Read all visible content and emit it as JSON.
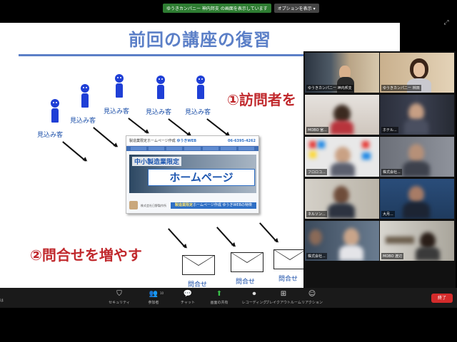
{
  "share_banner": {
    "status_text": "ゆうきカンパニー 神内邦支 の画面を表示しています",
    "options_button": "オプションを表示",
    "options_caret": "▾"
  },
  "top_right_icon": "⤢",
  "slide": {
    "title": "前回の講座の復習",
    "visitor_label": "見込み客",
    "callout_1": "①訪問者を",
    "callout_2": "②問合せを増やす",
    "inquiry_label": "問合せ",
    "homepage": {
      "brand_prefix": "製造業限定ホームページ作成 ",
      "brand_name": "ゆうきWEB",
      "phone": "06-6395-4262",
      "tagline": "中小製造業限定",
      "headline": "ホームページ",
      "caption": "株式会社日野製作所",
      "banner_prefix": "製造業限定",
      "banner_text": "ホームページ作成 ゆうきWEBの特徴"
    }
  },
  "participants": [
    {
      "name": "ゆうきカンパニー 神内邦支",
      "active": true
    },
    {
      "name": "ゆうきカンパニー 林田",
      "active": false
    },
    {
      "name": "MOBO 宮...",
      "active": false
    },
    {
      "name": "ホテル...",
      "active": false
    },
    {
      "name": "フロロコ...",
      "active": false
    },
    {
      "name": "株式会社...",
      "active": false
    },
    {
      "name": "ネルソン...",
      "active": false
    },
    {
      "name": "大月...",
      "active": false
    },
    {
      "name": "株式会社...",
      "active": false
    },
    {
      "name": "MOBO 渡辺",
      "active": false
    }
  ],
  "toolbar": {
    "left_text": "は",
    "participants_count": "10",
    "items": [
      {
        "label": "セキュリティ",
        "icon": "shield-icon",
        "glyph": "⛉"
      },
      {
        "label": "参加者",
        "icon": "participants-icon",
        "glyph": "👥"
      },
      {
        "label": "チャット",
        "icon": "chat-icon",
        "glyph": "💬"
      },
      {
        "label": "画面の共有",
        "icon": "share-screen-icon",
        "glyph": "⬆"
      },
      {
        "label": "レコーディング",
        "icon": "record-icon",
        "glyph": "⏺"
      },
      {
        "label": "ブレイクアウトルーム",
        "icon": "breakout-icon",
        "glyph": "⊞"
      },
      {
        "label": "リアクション",
        "icon": "reaction-icon",
        "glyph": "☺"
      }
    ],
    "end_label": "終了"
  },
  "colors": {
    "title_blue": "#5b7fc7",
    "callout_red": "#c0282c",
    "person_blue": "#1f3fd6",
    "share_green": "#39c24a",
    "end_red": "#d42b2b"
  }
}
